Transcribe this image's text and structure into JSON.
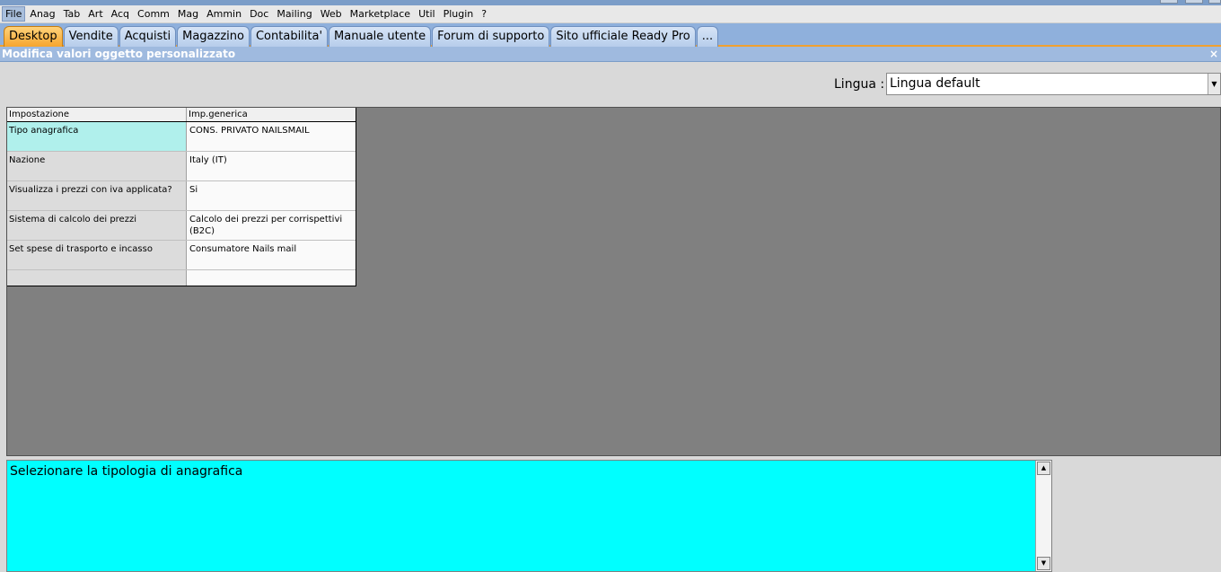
{
  "menu": [
    "File",
    "Anag",
    "Tab",
    "Art",
    "Acq",
    "Comm",
    "Mag",
    "Ammin",
    "Doc",
    "Mailing",
    "Web",
    "Marketplace",
    "Util",
    "Plugin",
    "?"
  ],
  "tabs": [
    "Desktop",
    "Vendite",
    "Acquisti",
    "Magazzino",
    "Contabilita'",
    "Manuale utente",
    "Forum di supporto",
    "Sito ufficiale Ready Pro",
    "..."
  ],
  "subtitle": "Modifica valori oggetto personalizzato",
  "close_glyph": "×",
  "lingua": {
    "label": "Lingua :",
    "value": "Lingua default"
  },
  "grid": {
    "headers": [
      "Impostazione",
      "Imp.generica"
    ],
    "rows": [
      {
        "key": "Tipo anagrafica",
        "value": "CONS. PRIVATO NAILSMAIL"
      },
      {
        "key": "Nazione",
        "value": "Italy (IT)"
      },
      {
        "key": "Visualizza i prezzi con iva applicata?",
        "value": "Si"
      },
      {
        "key": "Sistema di calcolo dei prezzi",
        "value": "Calcolo dei prezzi per corrispettivi (B2C)"
      },
      {
        "key": "Set spese di trasporto e incasso",
        "value": "Consumatore Nails mail"
      }
    ]
  },
  "description": "Selezionare la tipologia di anagrafica",
  "icons": {
    "dropdown": "chevron-down-icon",
    "scroll_up": "arrow-up-icon",
    "scroll_down": "arrow-down-icon",
    "close": "close-icon"
  }
}
